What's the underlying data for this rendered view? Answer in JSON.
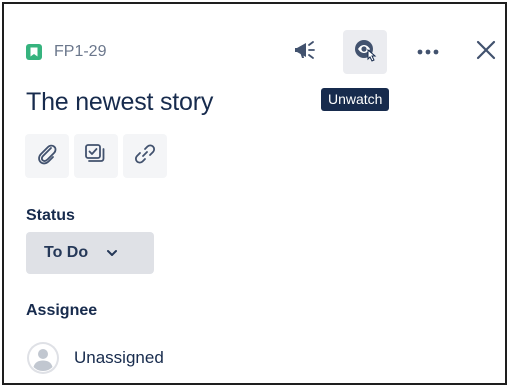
{
  "issue": {
    "key": "FP1-29",
    "type_icon": "story-icon",
    "title": "The newest story"
  },
  "header_actions": {
    "feedback_icon": "megaphone-icon",
    "watch_icon": "eye-icon",
    "more_icon": "more-icon",
    "close_icon": "close-icon",
    "tooltip": "Unwatch"
  },
  "quick_actions": [
    {
      "name": "attach",
      "icon": "paperclip-icon"
    },
    {
      "name": "subtask",
      "icon": "subtask-icon"
    },
    {
      "name": "link",
      "icon": "link-icon"
    }
  ],
  "status": {
    "label": "Status",
    "value": "To Do"
  },
  "assignee": {
    "label": "Assignee",
    "value": "Unassigned"
  },
  "colors": {
    "story_green": "#36b37e",
    "tooltip_bg": "#172b4d",
    "text_primary": "#172b4d",
    "text_secondary": "#6b778c",
    "button_bg": "#dfe1e6"
  }
}
